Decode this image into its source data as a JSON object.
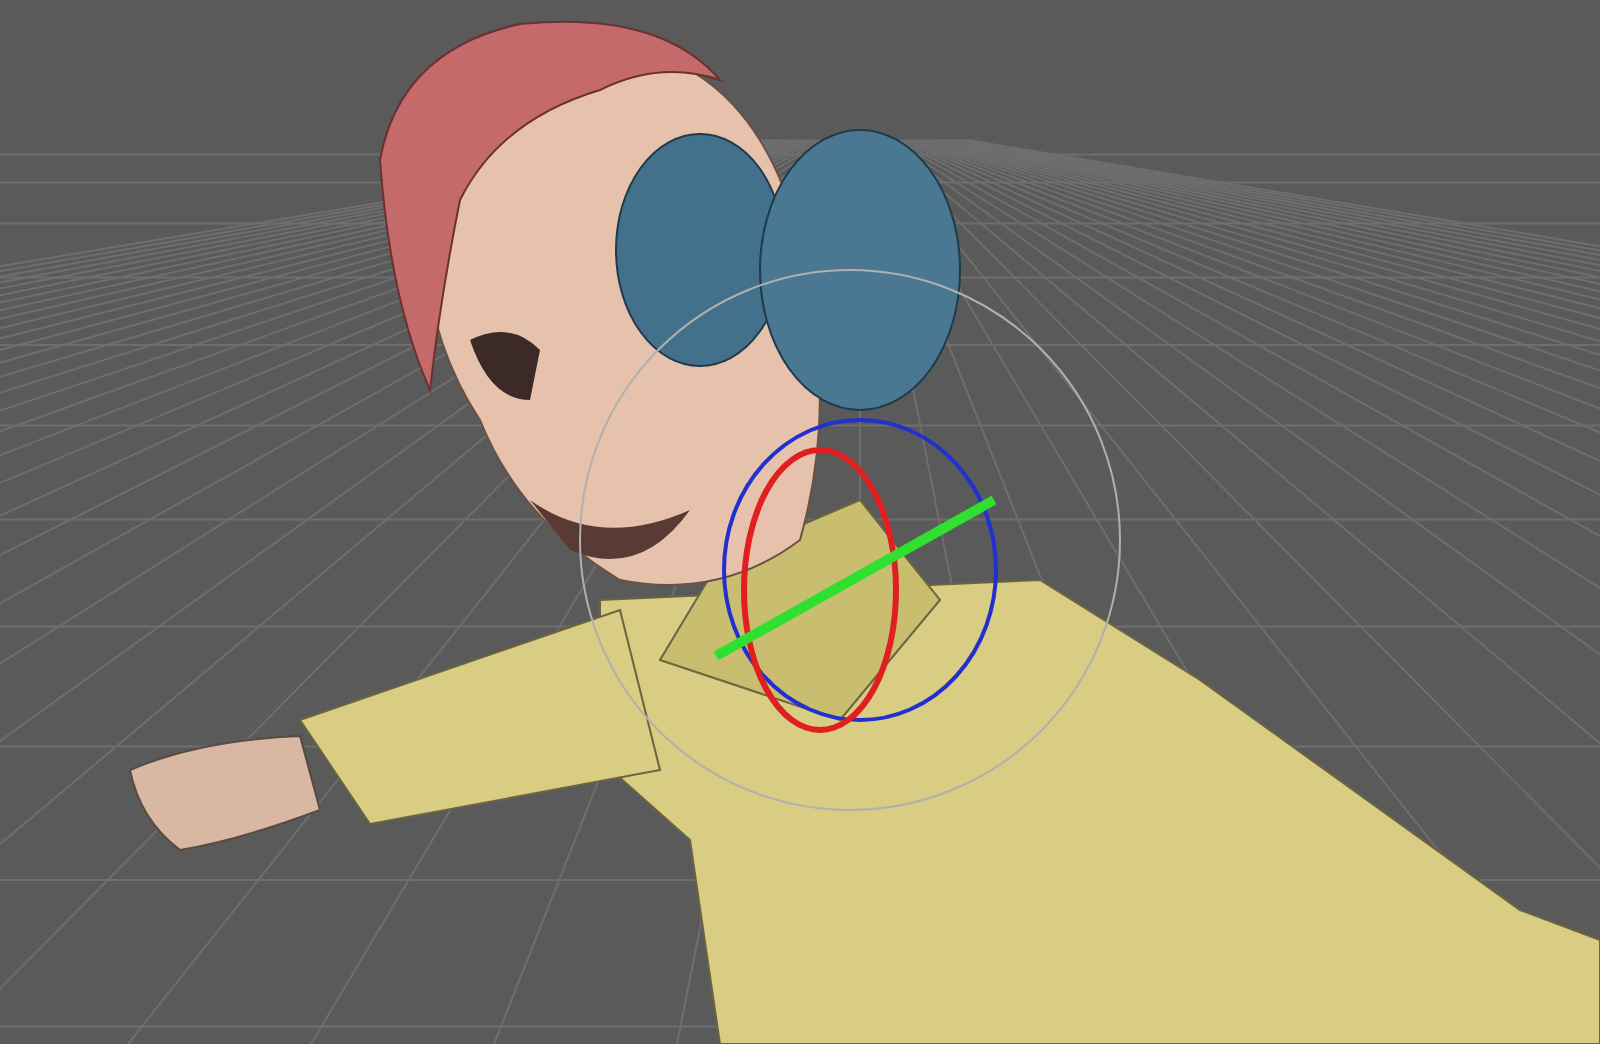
{
  "viewport": {
    "show_grid": true
  }
}
